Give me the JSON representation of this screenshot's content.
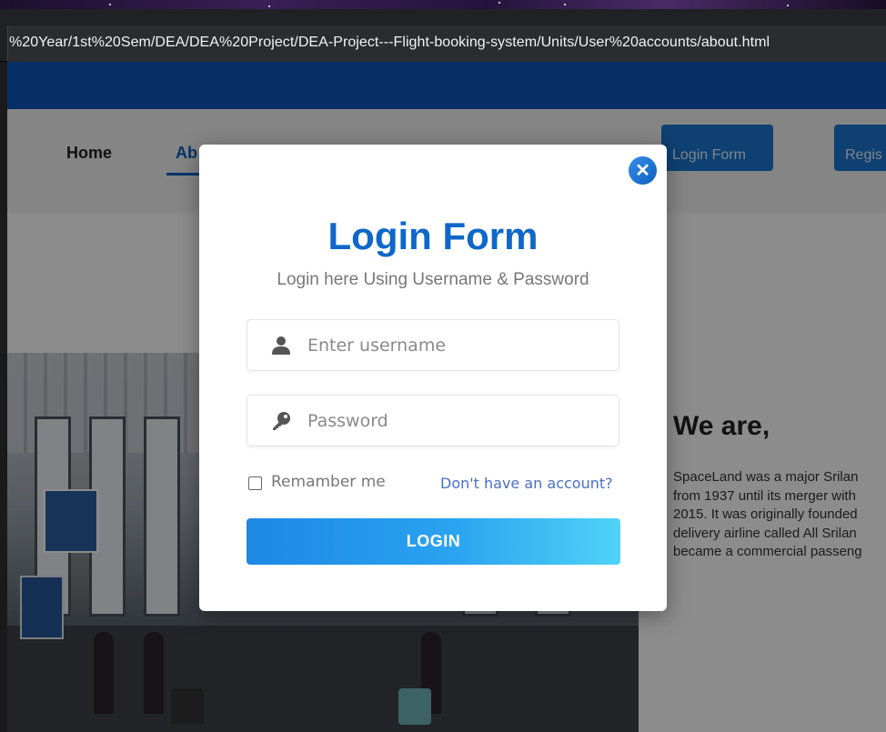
{
  "browser": {
    "url": "%20Year/1st%20Sem/DEA/DEA%20Project/DEA-Project---Flight-booking-system/Units/User%20accounts/about.html"
  },
  "nav": {
    "home": "Home",
    "about": "Ab",
    "login_button": "Login Form",
    "register_button": "Regis"
  },
  "about": {
    "heading": "We are,",
    "lines": [
      "SpaceLand was a major Srilan",
      "from 1937 until its merger with",
      "2015. It was originally founded",
      "delivery airline called All Srilan",
      "became a commercial passeng"
    ]
  },
  "modal": {
    "title": "Login Form",
    "subtitle": "Login here Using Username & Password",
    "username_placeholder": "Enter username",
    "password_placeholder": "Password",
    "remember_label": "Remamber me",
    "signup_link": "Don't have an account?",
    "login_button": "LOGIN",
    "close_symbol": "✕"
  },
  "icons": {
    "close": "close-icon",
    "user": "user-icon",
    "key": "key-icon"
  },
  "colors": {
    "brand_blue": "#0f67c9",
    "header_bar": "#0a56b8",
    "button_gradient_start": "#1e88e5",
    "button_gradient_end": "#4fd3f7"
  }
}
